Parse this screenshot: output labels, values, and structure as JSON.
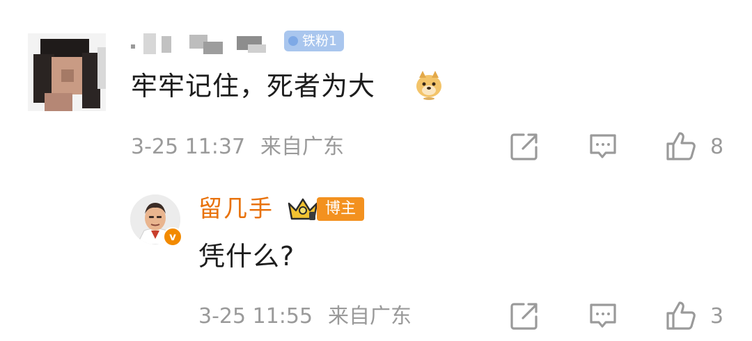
{
  "comment": {
    "badge": "铁粉1",
    "text": "牢牢记住，死者为大",
    "emoji_icon": "doge-emoji-icon",
    "time": "3-25 11:37",
    "location": "来自广东",
    "like_count": "8"
  },
  "reply": {
    "author": "留几手",
    "badge": "博主",
    "verified_mark": "v",
    "text": "凭什么?",
    "time": "3-25 11:55",
    "location": "来自广东",
    "like_count": "3"
  },
  "colors": {
    "accent_orange": "#e8720c",
    "meta_gray": "#9a9a9a",
    "fan_badge_blue": "#a9c6ee",
    "host_badge_orange": "#f3911f"
  }
}
